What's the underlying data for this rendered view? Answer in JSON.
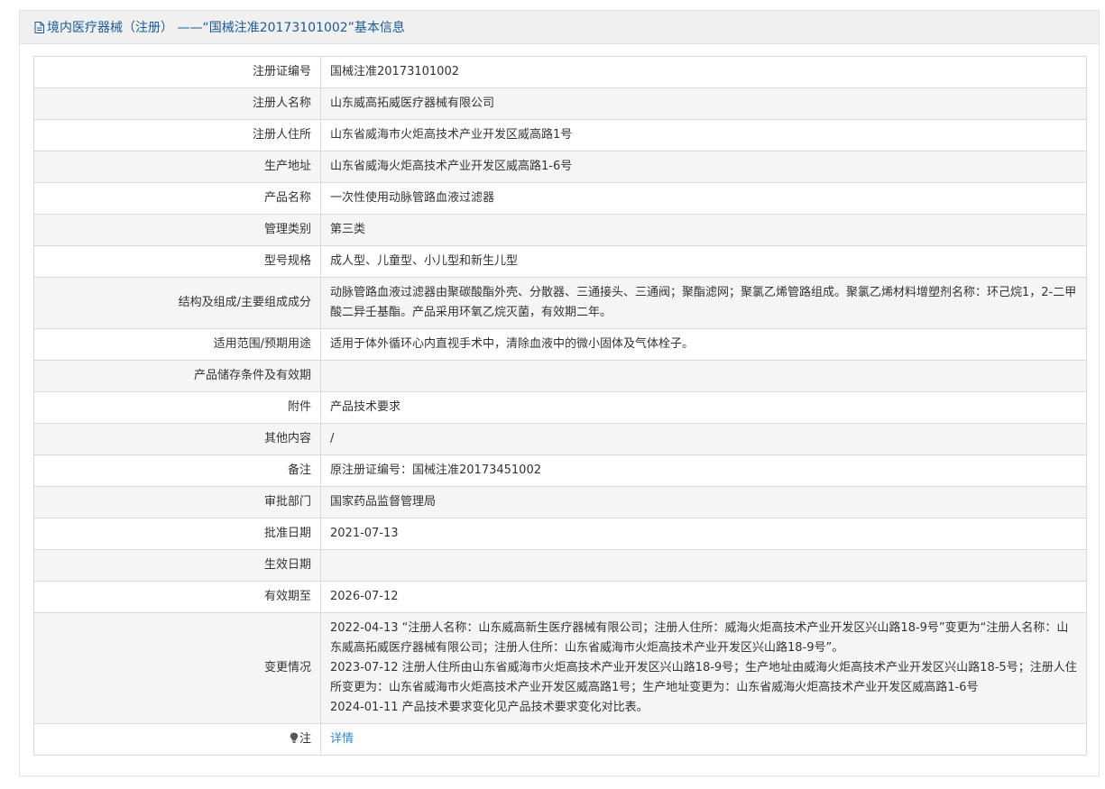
{
  "header": {
    "icon": "document-icon",
    "title": "境内医疗器械（注册） ——“国械注准20173101002”基本信息"
  },
  "rows": [
    {
      "label": "注册证编号",
      "value": "国械注准20173101002"
    },
    {
      "label": "注册人名称",
      "value": "山东威高拓威医疗器械有限公司"
    },
    {
      "label": "注册人住所",
      "value": "山东省威海市火炬高技术产业开发区威高路1号"
    },
    {
      "label": "生产地址",
      "value": "山东省威海火炬高技术产业开发区威高路1-6号"
    },
    {
      "label": "产品名称",
      "value": "一次性使用动脉管路血液过滤器"
    },
    {
      "label": "管理类别",
      "value": "第三类"
    },
    {
      "label": "型号规格",
      "value": "成人型、儿童型、小儿型和新生儿型"
    },
    {
      "label": "结构及组成/主要组成成分",
      "value": "动脉管路血液过滤器由聚碳酸酯外壳、分散器、三通接头、三通阀；聚酯滤网；聚氯乙烯管路组成。聚氯乙烯材料增塑剂名称：环己烷1，2-二甲酸二异壬基酯。产品采用环氧乙烷灭菌，有效期二年。"
    },
    {
      "label": "适用范围/预期用途",
      "value": "适用于体外循环心内直视手术中，清除血液中的微小固体及气体栓子。"
    },
    {
      "label": "产品储存条件及有效期",
      "value": ""
    },
    {
      "label": "附件",
      "value": "产品技术要求"
    },
    {
      "label": "其他内容",
      "value": "/"
    },
    {
      "label": "备注",
      "value": "原注册证编号：国械注准20173451002"
    },
    {
      "label": "审批部门",
      "value": "国家药品监督管理局"
    },
    {
      "label": "批准日期",
      "value": "2021-07-13"
    },
    {
      "label": "生效日期",
      "value": ""
    },
    {
      "label": "有效期至",
      "value": "2026-07-12"
    }
  ],
  "changes": {
    "label": "变更情况",
    "entries": [
      "2022-04-13 “注册人名称：山东威高新生医疗器械有限公司；注册人住所：威海火炬高技术产业开发区兴山路18-9号”变更为“注册人名称：山东威高拓威医疗器械有限公司；注册人住所：山东省威海市火炬高技术产业开发区兴山路18-9号”。",
      "2023-07-12 注册人住所由山东省威海市火炬高技术产业开发区兴山路18-9号；生产地址由威海火炬高技术产业开发区兴山路18-5号；注册人住所变更为：山东省威海市火炬高技术产业开发区威高路1号；生产地址变更为：山东省威海火炬高技术产业开发区威高路1-6号",
      "2024-01-11 产品技术要求变化见产品技术要求变化对比表。"
    ]
  },
  "note": {
    "icon": "lightbulb-icon",
    "label": "注",
    "link_text": "详情"
  }
}
